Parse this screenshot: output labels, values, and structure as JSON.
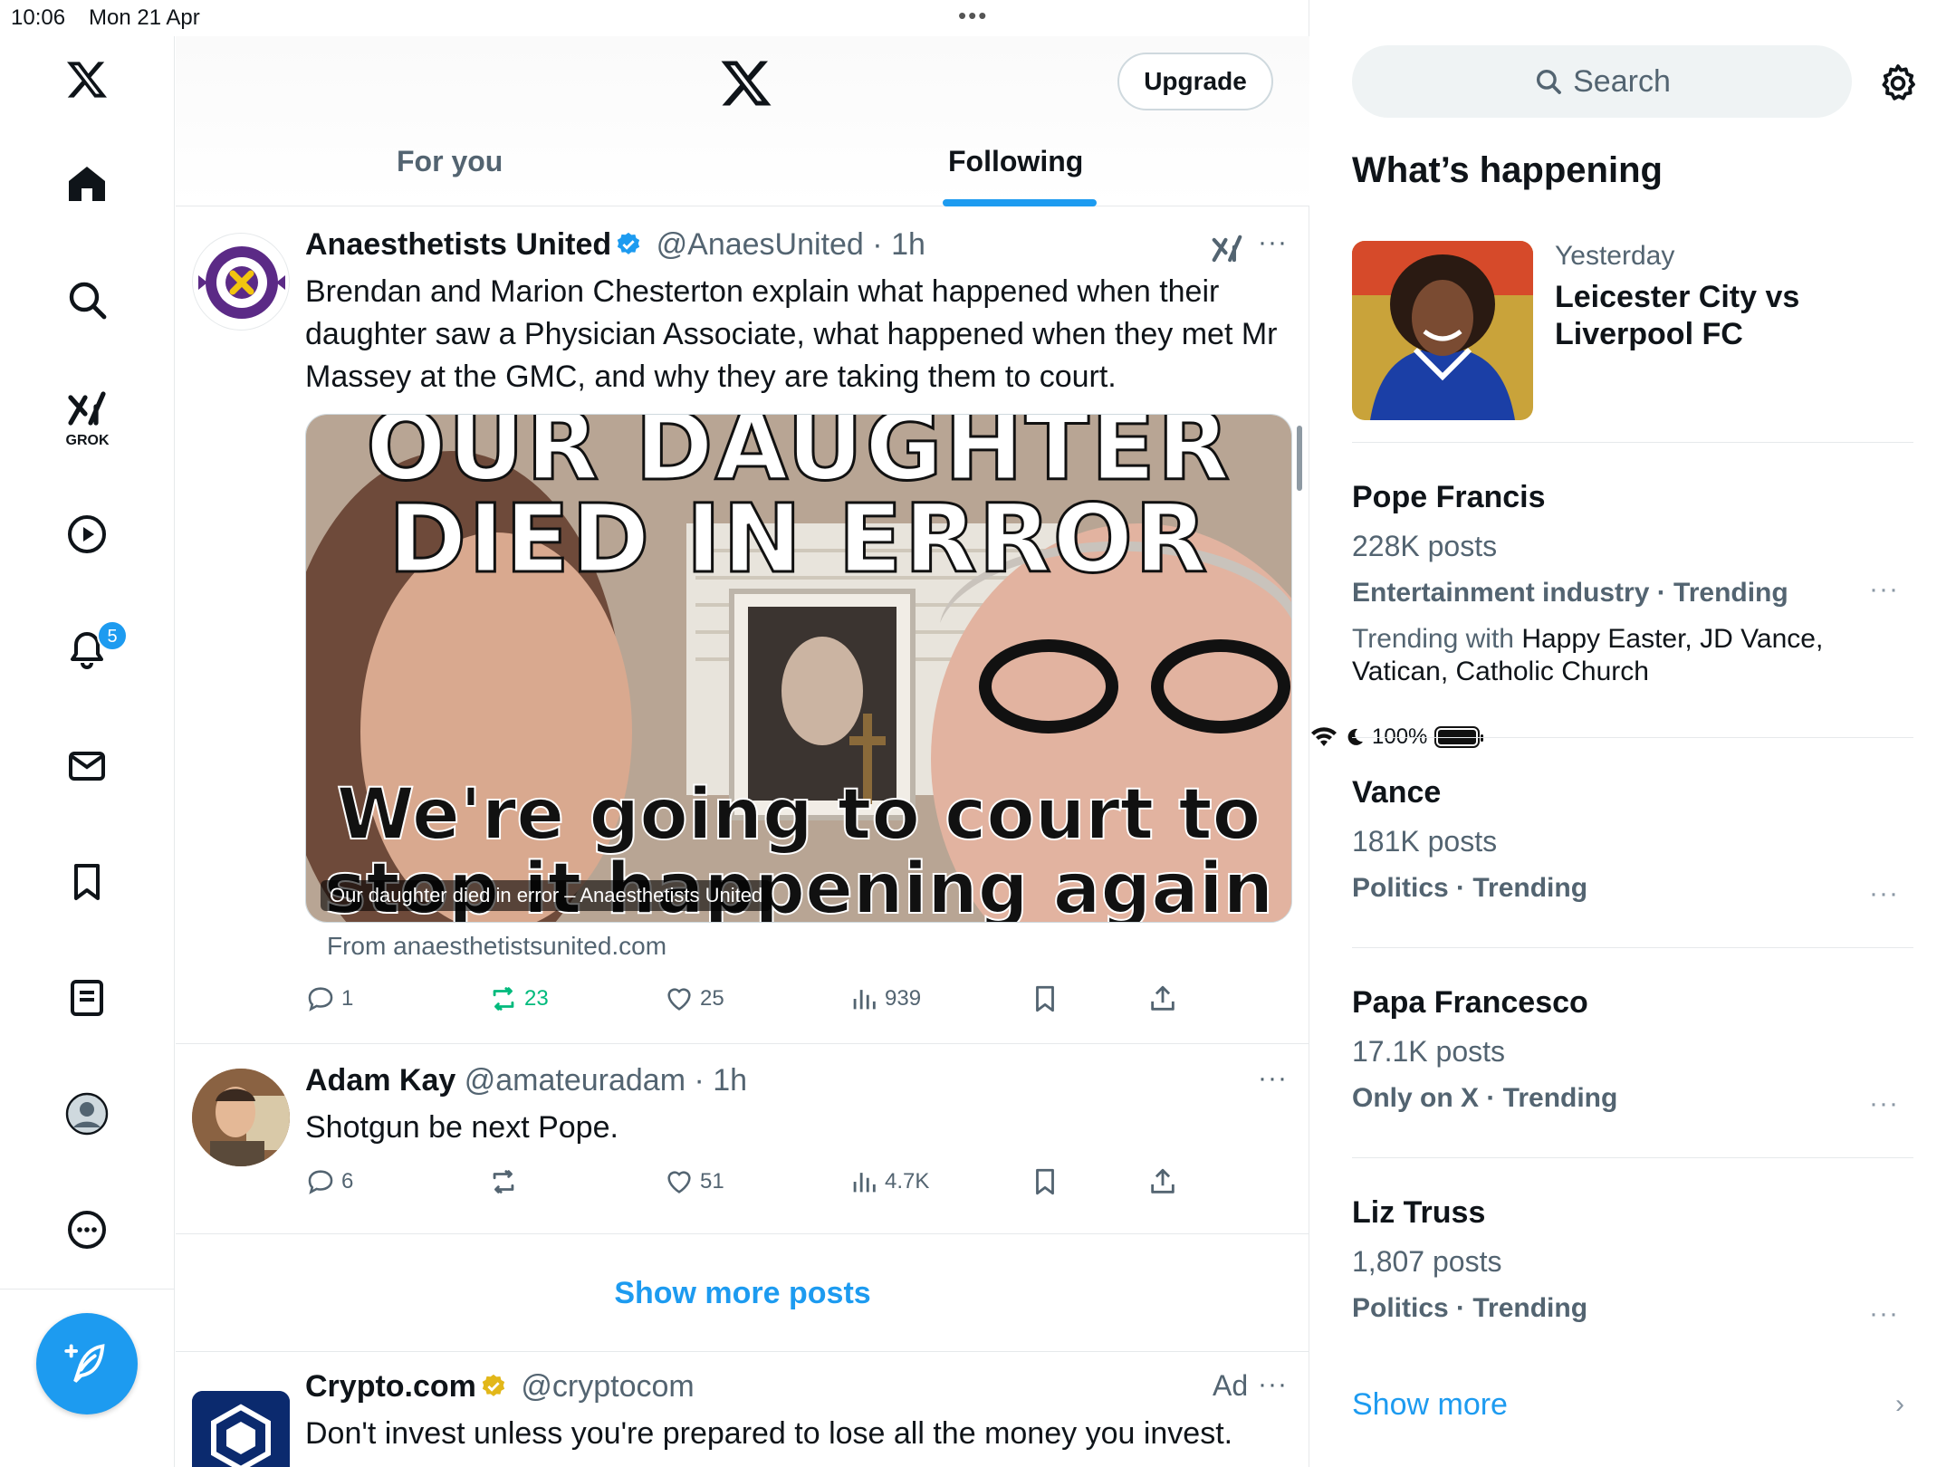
{
  "status_bar": {
    "time": "10:06",
    "date": "Mon 21 Apr",
    "battery": "100%"
  },
  "nav": {
    "grok_label": "GROK",
    "notifications_badge": "5"
  },
  "header": {
    "upgrade_label": "Upgrade",
    "tabs": [
      {
        "label": "For you"
      },
      {
        "label": "Following"
      }
    ]
  },
  "posts": [
    {
      "author": "Anaesthetists United",
      "handle": "@AnaesUnited",
      "time": "· 1h",
      "text": "Brendan and Marion Chesterton  explain what happened when their daughter saw a Physician Associate, what happened when they met Mr Massey at the GMC, and why they are taking them to court.",
      "media_headline_1": "OUR DAUGHTER",
      "media_headline_2": "DIED IN ERROR",
      "media_sub_1": "We're going to court to",
      "media_sub_2": "stop it happening again",
      "media_caption": "Our daughter died in error – Anaesthetists United",
      "link_from": "From anaesthetistsunited.com",
      "stats": {
        "replies": "1",
        "reposts": "23",
        "likes": "25",
        "views": "939"
      }
    },
    {
      "author": "Adam Kay",
      "handle": "@amateuradam",
      "time": "· 1h",
      "text": "Shotgun be next Pope.",
      "stats": {
        "replies": "6",
        "reposts": "",
        "likes": "51",
        "views": "4.7K"
      }
    },
    {
      "author": "Crypto.com",
      "handle": "@cryptocom",
      "ad_label": "Ad",
      "text": "Don't invest unless you're prepared to lose all the money you invest."
    }
  ],
  "show_more_posts": "Show more posts",
  "sidebar": {
    "search_placeholder": "Search",
    "whats_happening": "What’s happening",
    "feature": {
      "when": "Yesterday",
      "title": "Leicester City vs Liverpool FC"
    },
    "trends": [
      {
        "title": "Pope Francis",
        "posts": "228K posts",
        "category": "Entertainment industry · Trending",
        "with_label": "Trending with",
        "with_items": "Happy Easter, JD Vance, Vatican, Catholic Church"
      },
      {
        "title": "Vance",
        "posts": "181K posts",
        "category": "Politics · Trending"
      },
      {
        "title": "Papa Francesco",
        "posts": "17.1K posts",
        "category": "Only on X · Trending"
      },
      {
        "title": "Liz Truss",
        "posts": "1,807 posts",
        "category": "Politics · Trending"
      }
    ],
    "show_more": "Show more"
  },
  "colors": {
    "accent": "#1d9bf0",
    "repost_active": "#00ba7c",
    "text_primary": "#0f1419",
    "text_secondary": "#536471"
  }
}
